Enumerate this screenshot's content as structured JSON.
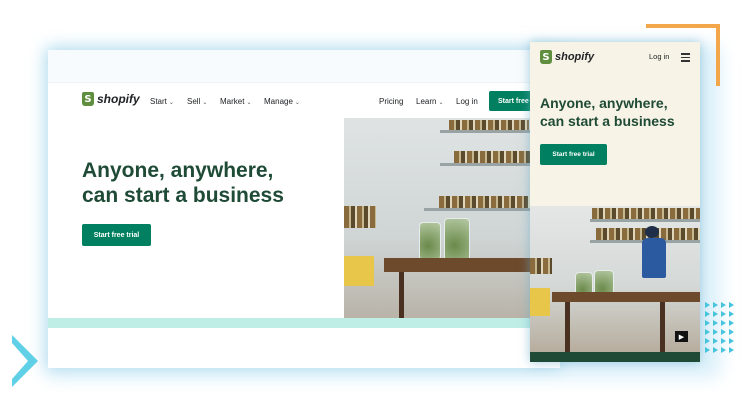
{
  "brand": {
    "logo_text": "shopify",
    "logo_glyph": "S"
  },
  "desktop": {
    "nav": {
      "items": [
        {
          "label": "Start",
          "chevron": "⌄"
        },
        {
          "label": "Sell",
          "chevron": "⌄"
        },
        {
          "label": "Market",
          "chevron": "⌄"
        },
        {
          "label": "Manage",
          "chevron": "⌄"
        }
      ],
      "right": {
        "pricing": "Pricing",
        "learn": "Learn",
        "learn_chevron": "⌄",
        "login": "Log in",
        "cta": "Start free"
      }
    },
    "hero": {
      "title_line1": "Anyone, anywhere,",
      "title_line2": "can start a business",
      "cta": "Start free trial"
    }
  },
  "mobile": {
    "login": "Log in",
    "menu_icon": "hamburger-icon",
    "hero": {
      "title_line1": "Anyone, anywhere,",
      "title_line2": "can start a business",
      "cta": "Start free trial"
    },
    "play_icon": "▶"
  },
  "colors": {
    "brand_green": "#008060",
    "heading_green": "#1e4a36",
    "accent_orange": "#f3a74a",
    "accent_cyan": "#45c4dd",
    "mint": "#bfeee6"
  }
}
